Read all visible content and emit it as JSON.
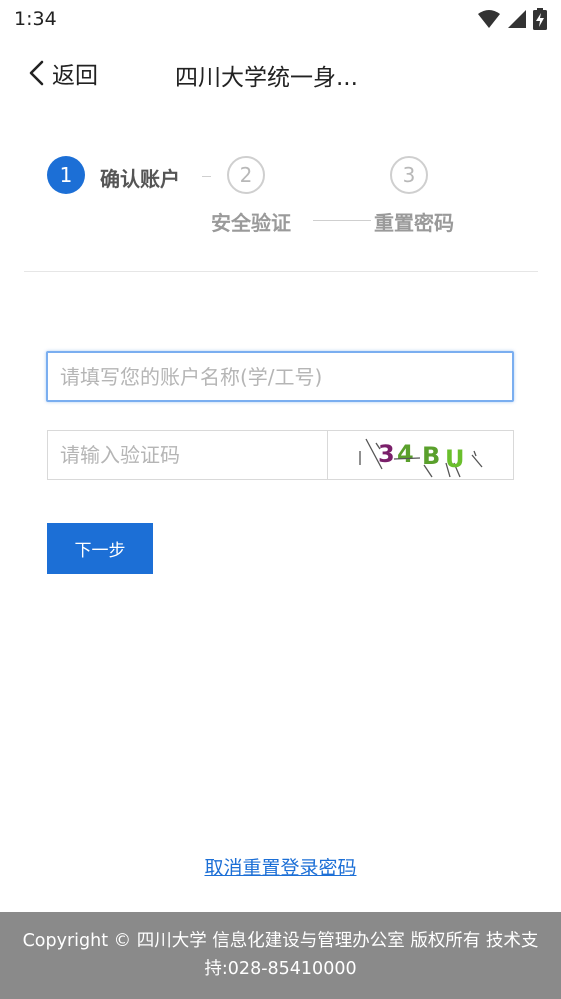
{
  "status_bar": {
    "time": "1:34",
    "icons": [
      "wifi-icon",
      "cell-signal-icon",
      "battery-charging-icon"
    ]
  },
  "nav": {
    "back_label": "返回",
    "title": "四川大学统一身..."
  },
  "steps": [
    {
      "number": "1",
      "label": "确认账户",
      "state": "active"
    },
    {
      "number": "2",
      "label": "安全验证",
      "state": "inactive"
    },
    {
      "number": "3",
      "label": "重置密码",
      "state": "inactive"
    }
  ],
  "form": {
    "account_placeholder": "请填写您的账户名称(学/工号)",
    "account_value": "",
    "captcha_placeholder": "请输入验证码",
    "captcha_value": "",
    "captcha_image_text": [
      "3",
      "4",
      "B",
      "U"
    ],
    "next_label": "下一步"
  },
  "cancel_link": "取消重置登录密码",
  "footer": {
    "line1": "Copyright © 四川大学 信息化建设与管理办公室 版权所有 技术支",
    "line2": "持:028-85410000"
  },
  "colors": {
    "accent": "#1c6fd6",
    "footer_bg": "#8a8a8a"
  }
}
